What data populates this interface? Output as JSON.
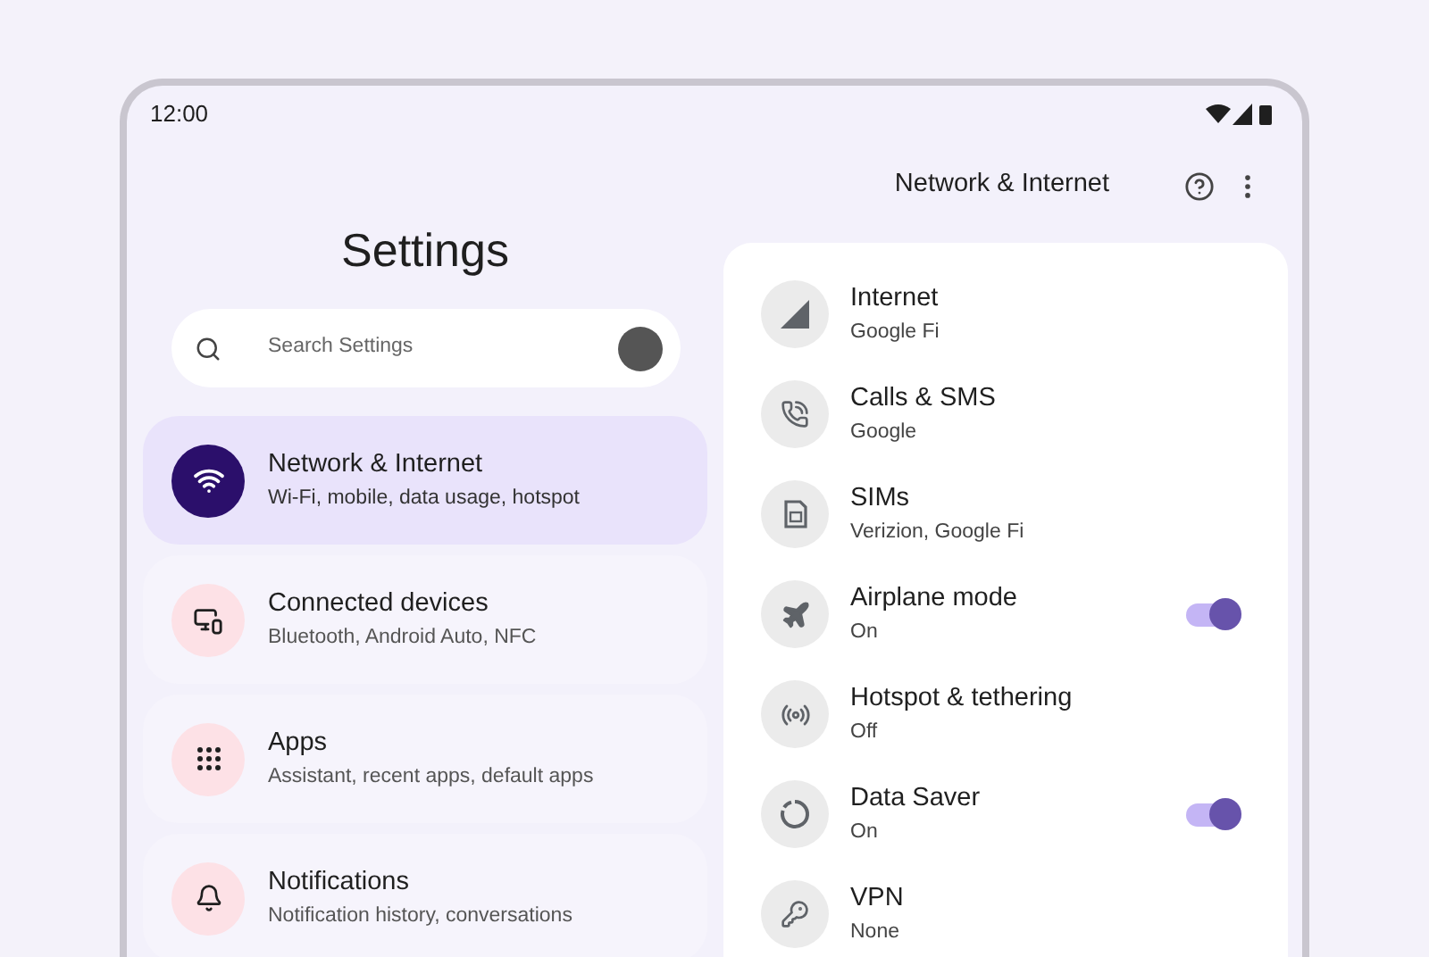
{
  "status_bar": {
    "time": "12:00"
  },
  "left_pane": {
    "title": "Settings",
    "search": {
      "placeholder": "Search Settings"
    },
    "items": [
      {
        "title": "Network & Internet",
        "subtitle": "Wi-Fi, mobile, data usage, hotspot",
        "selected": true
      },
      {
        "title": "Connected devices",
        "subtitle": "Bluetooth, Android Auto, NFC",
        "selected": false
      },
      {
        "title": "Apps",
        "subtitle": "Assistant, recent apps, default apps",
        "selected": false
      },
      {
        "title": "Notifications",
        "subtitle": "Notification history, conversations",
        "selected": false
      }
    ]
  },
  "right_pane": {
    "title": "Network & Internet",
    "items": [
      {
        "kind": "link",
        "title": "Internet",
        "subtitle": "Google Fi"
      },
      {
        "kind": "link",
        "title": "Calls & SMS",
        "subtitle": "Google"
      },
      {
        "kind": "link",
        "title": "SIMs",
        "subtitle": "Verizion, Google Fi"
      },
      {
        "kind": "toggle",
        "title": "Airplane mode",
        "subtitle": "On",
        "on": true
      },
      {
        "kind": "link",
        "title": "Hotspot & tethering",
        "subtitle": "Off"
      },
      {
        "kind": "toggle",
        "title": "Data Saver",
        "subtitle": "On",
        "on": true
      },
      {
        "kind": "link",
        "title": "VPN",
        "subtitle": "None"
      }
    ]
  }
}
